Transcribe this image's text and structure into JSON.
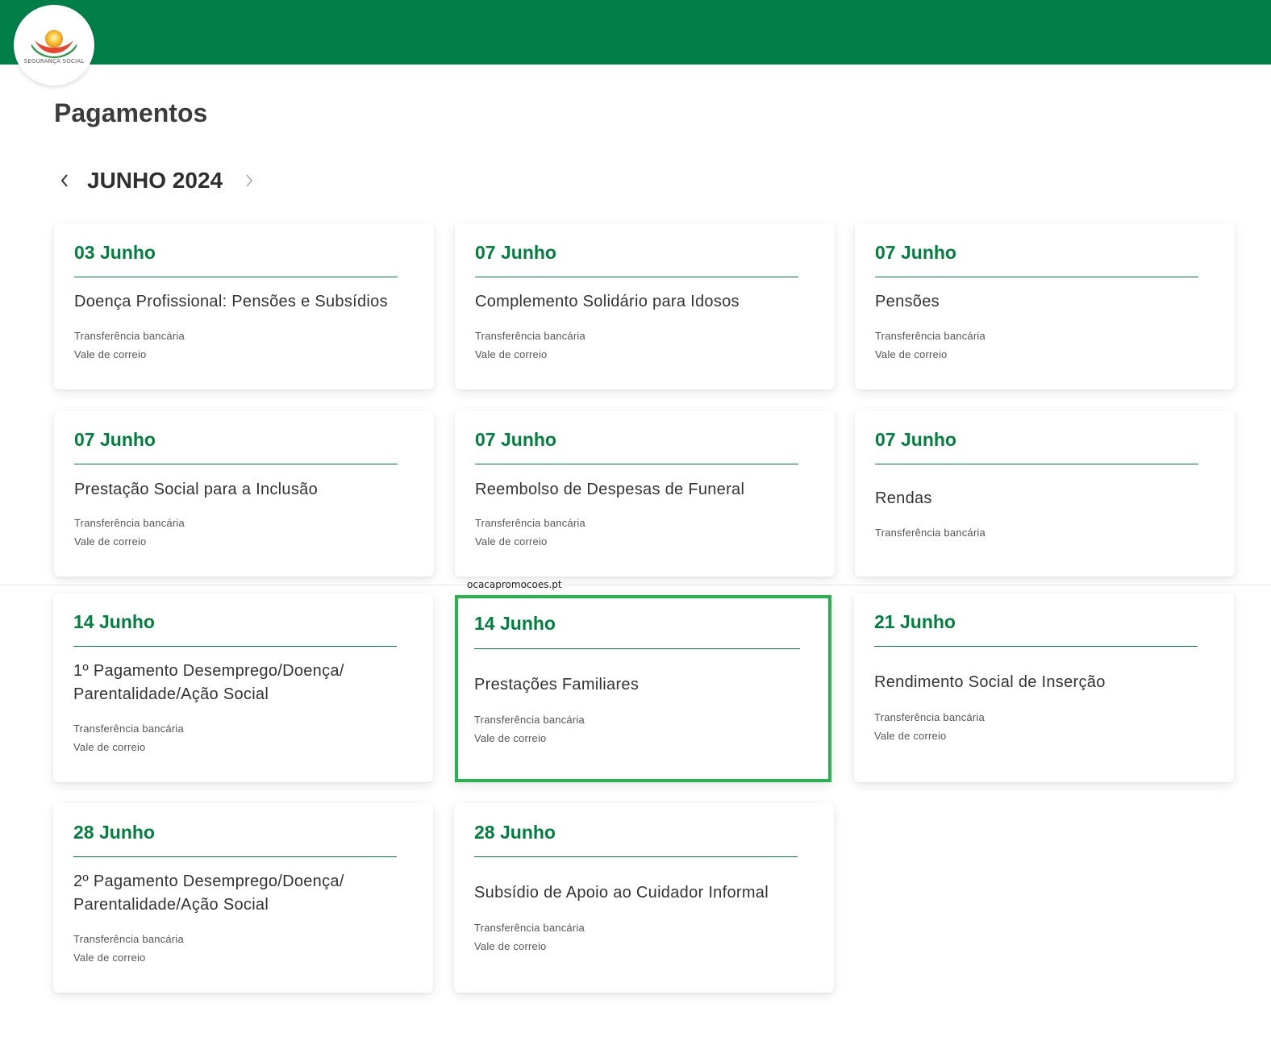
{
  "header": {
    "logo_text": "SEGURANÇA SOCIAL",
    "brand_color": "#008048"
  },
  "page": {
    "title": "Pagamentos"
  },
  "month_nav": {
    "label": "JUNHO 2024",
    "prev_icon": "chevron-left-icon",
    "next_icon": "chevron-right-icon"
  },
  "cards": [
    {
      "date": "03 Junho",
      "title": "Doença Profissional: Pensões e Subsídios",
      "methods": [
        "Transferência bancária",
        "Vale de correio"
      ]
    },
    {
      "date": "07 Junho",
      "title": "Complemento Solidário para Idosos",
      "methods": [
        "Transferência bancária",
        "Vale de correio"
      ]
    },
    {
      "date": "07 Junho",
      "title": "Pensões",
      "methods": [
        "Transferência bancária",
        "Vale de correio"
      ]
    },
    {
      "date": "07 Junho",
      "title": "Prestação Social para a Inclusão",
      "methods": [
        "Transferência bancária",
        "Vale de correio"
      ]
    },
    {
      "date": "07 Junho",
      "title": "Reembolso de Despesas de Funeral",
      "methods": [
        "Transferência bancária",
        "Vale de correio"
      ]
    },
    {
      "date": "07 Junho",
      "title": "Rendas",
      "methods": [
        "Transferência bancária"
      ]
    },
    {
      "date": "14 Junho",
      "title": "1º Pagamento Desemprego/Doença/ Parentalidade/Ação Social",
      "methods": [
        "Transferência bancária",
        "Vale de correio"
      ]
    },
    {
      "date": "14 Junho",
      "title": "Prestações Familiares",
      "methods": [
        "Transferência bancária",
        "Vale de correio"
      ],
      "highlighted": true
    },
    {
      "date": "21 Junho",
      "title": "Rendimento Social de Inserção",
      "methods": [
        "Transferência bancária",
        "Vale de correio"
      ]
    },
    {
      "date": "28 Junho",
      "title": "2º Pagamento Desemprego/Doença/ Parentalidade/Ação Social",
      "methods": [
        "Transferência bancária",
        "Vale de correio"
      ]
    },
    {
      "date": "28 Junho",
      "title": "Subsídio de Apoio ao Cuidador Informal",
      "methods": [
        "Transferência bancária",
        "Vale de correio"
      ]
    }
  ],
  "watermark": "ocacapromocoes.pt",
  "colors": {
    "accent_green": "#00803d",
    "highlight_border": "#29b24f"
  }
}
